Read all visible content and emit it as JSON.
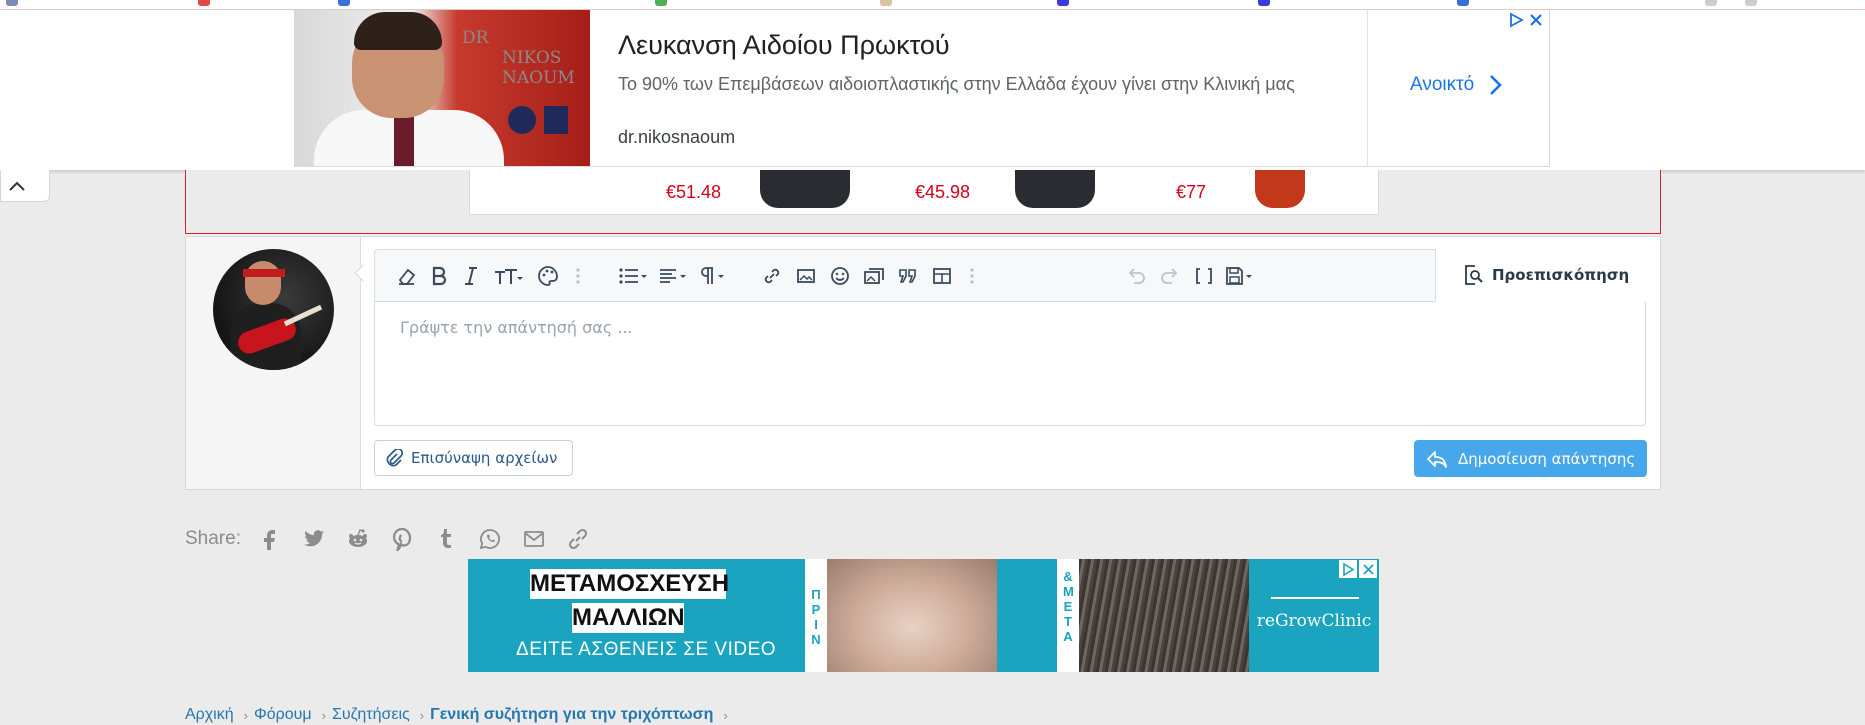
{
  "top_ad": {
    "title": "Λευκανση Αιδοίου Πρωκτού",
    "description": "Το 90% των Επεμβάσεων αιδοιοπλαστικής στην Ελλάδα έχουν γίνει στην Κλινική μας",
    "domain": "dr.nikosnaoum",
    "cta": "Ανοικτό",
    "logo_line1": "DR",
    "logo_line2": "NIKOS",
    "logo_line3": "NAOUM"
  },
  "product_strip": {
    "prices": [
      "€51.48",
      "€45.98",
      "€77"
    ]
  },
  "editor": {
    "placeholder": "Γράψτε την απάντησή σας ...",
    "preview_label": "Προεπισκόπηση",
    "attach_label": "Επισύναψη αρχείων",
    "post_label": "Δημοσίευση απάντησης",
    "toolbar_icons": [
      "eraser-icon",
      "bold-icon",
      "italic-icon",
      "text-size-icon",
      "palette-icon",
      "more-vertical-icon",
      "list-icon",
      "align-icon",
      "paragraph-icon",
      "link-icon",
      "image-icon",
      "smiley-icon",
      "media-icon",
      "quote-icon",
      "table-icon",
      "more-vertical-icon",
      "undo-icon",
      "redo-icon",
      "brackets-icon",
      "save-icon"
    ]
  },
  "share": {
    "label": "Share:",
    "icons": [
      "facebook-icon",
      "twitter-icon",
      "reddit-icon",
      "pinterest-icon",
      "tumblr-icon",
      "whatsapp-icon",
      "email-icon",
      "link-icon"
    ]
  },
  "bottom_ad": {
    "headline1": "ΜΕΤΑΜΟΣΧΕΥΣΗ",
    "headline2": "ΜΑΛΛΙΩΝ",
    "subline": "ΔΕΙΤΕ ΑΣΘΕΝΕΙΣ ΣΕ VIDEO",
    "before": "ΠΡΙΝ",
    "after": "& ΜΕΤΑ",
    "brand": "reGrowClinic"
  },
  "breadcrumb": {
    "items": [
      "Αρχική",
      "Φόρουμ",
      "Συζητήσεις",
      "Γενική συζήτηση για την τριχόπτωση"
    ]
  },
  "colors": {
    "accent": "#47a7eb",
    "link": "#2577b1",
    "price": "#d4001a",
    "ad_teal": "#1aa4bf",
    "ad_link": "#1a73e8"
  }
}
